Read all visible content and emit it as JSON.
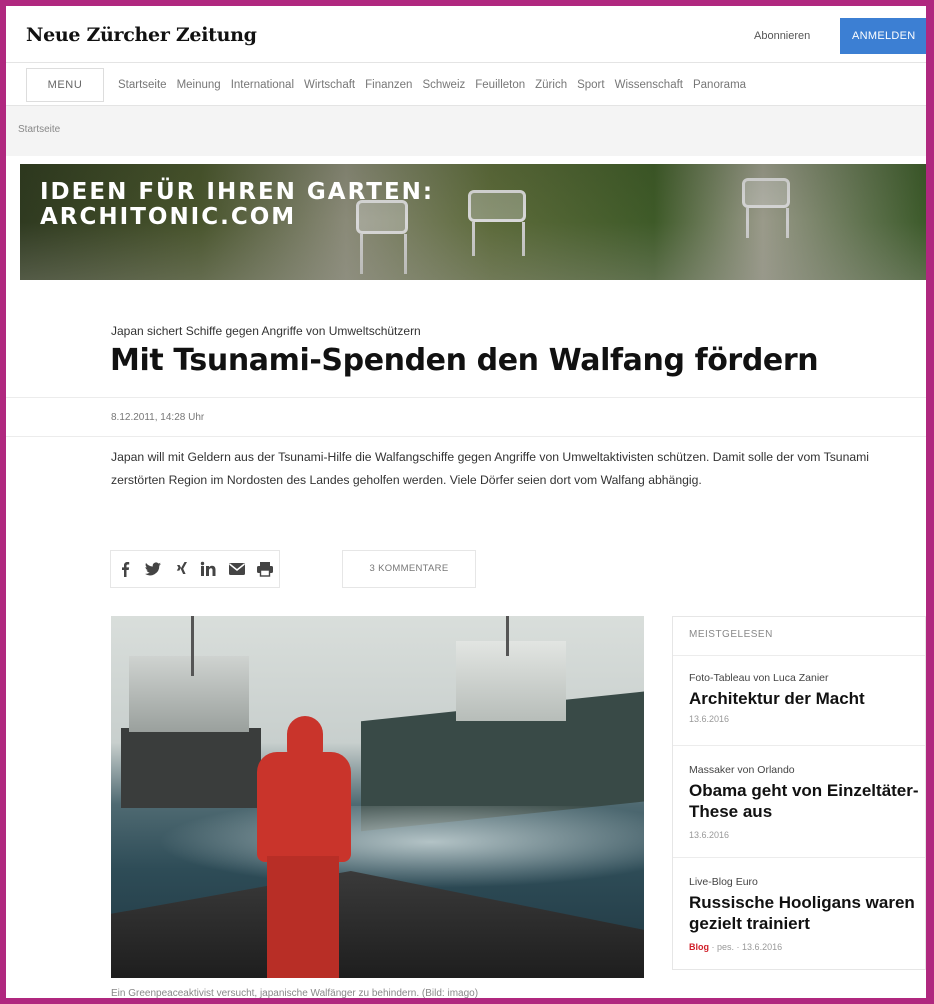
{
  "header": {
    "logo": "Neue Zürcher Zeitung",
    "subscribe_label": "Abonnieren",
    "login_label": "ANMELDEN"
  },
  "nav": {
    "menu_label": "MENU",
    "items": [
      "Startseite",
      "Meinung",
      "International",
      "Wirtschaft",
      "Finanzen",
      "Schweiz",
      "Feuilleton",
      "Zürich",
      "Sport",
      "Wissenschaft",
      "Panorama"
    ]
  },
  "breadcrumb": "Startseite",
  "banner": {
    "line1": "IDEEN FÜR IHREN GARTEN:",
    "line2": "ARCHITONIC.COM"
  },
  "article": {
    "kicker": "Japan sichert Schiffe gegen Angriffe von Umweltschützern",
    "headline": "Mit Tsunami-Spenden den Walfang fördern",
    "date": "8.12.2011, 14:28 Uhr",
    "lead": "Japan will mit Geldern aus der Tsunami-Hilfe die Walfangschiffe gegen Angriffe von Umweltaktivisten schützen. Damit solle der vom Tsunami zerstörten Region im Nordosten des Landes geholfen werden. Viele Dörfer seien dort vom Walfang abhängig.",
    "comments_label": "3 KOMMENTARE",
    "share_icons": [
      "facebook-icon",
      "twitter-icon",
      "xing-icon",
      "linkedin-icon",
      "mail-icon",
      "print-icon"
    ],
    "photo_caption": "Ein Greenpeaceaktivist versucht, japanische Walfänger zu behindern. (Bild: imago)"
  },
  "sidebar": {
    "title": "MEISTGELESEN",
    "items": [
      {
        "kicker": "Foto-Tableau von Luca Zanier",
        "title": "Architektur der Macht",
        "date": "13.6.2016"
      },
      {
        "kicker": "Massaker von Orlando",
        "title": "Obama geht von Einzeltäter-These aus",
        "date": "13.6.2016"
      },
      {
        "kicker": "Live-Blog Euro",
        "title": "Russische Hooligans waren gezielt trainiert",
        "badge": "Blog",
        "author": "pes.",
        "date": "13.6.2016"
      }
    ]
  },
  "colors": {
    "frame": "#b0287f",
    "login_button": "#3c7fd3",
    "blog_badge": "#d0202a"
  }
}
